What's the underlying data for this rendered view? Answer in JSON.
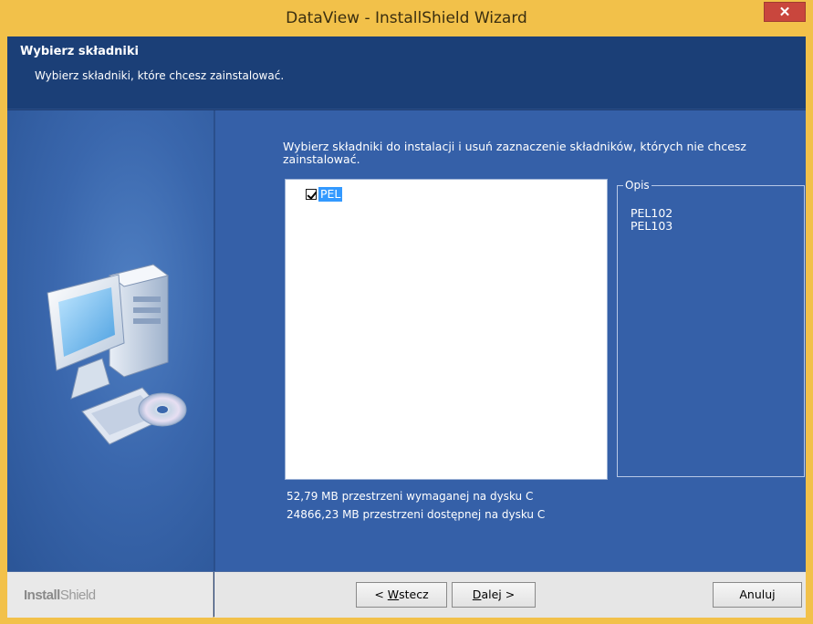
{
  "window": {
    "title": "DataView - InstallShield Wizard",
    "close_glyph": "✕"
  },
  "header": {
    "title": "Wybierz składniki",
    "subtitle": "Wybierz składniki, które chcesz zainstalować."
  },
  "main": {
    "instruction": "Wybierz składniki do instalacji i usuń zaznaczenie składników, których nie chcesz zainstalować.",
    "tree": {
      "items": [
        {
          "label": "PEL",
          "checked": true,
          "selected": true
        }
      ]
    },
    "description": {
      "legend": "Opis",
      "lines": [
        "PEL102",
        "PEL103"
      ]
    },
    "space_required": "52,79 MB przestrzeni wymaganej na dysku C",
    "space_available": "24866,23 MB przestrzeni dostępnej na dysku C"
  },
  "footer": {
    "brand_bold": "Install",
    "brand_light": "Shield",
    "back_label_pre": "< ",
    "back_label_key": "W",
    "back_label_post": "stecz",
    "next_label_key": "D",
    "next_label_post": "alej >",
    "cancel_label": "Anuluj"
  },
  "colors": {
    "titlebar": "#f2c14a",
    "header_bg": "#1b3f77",
    "main_bg": "#3560a8",
    "selection": "#3399ff",
    "close_button": "#c9463d"
  },
  "icons": [
    "close-icon",
    "computer-cd-icon",
    "checkbox-checked-icon"
  ]
}
